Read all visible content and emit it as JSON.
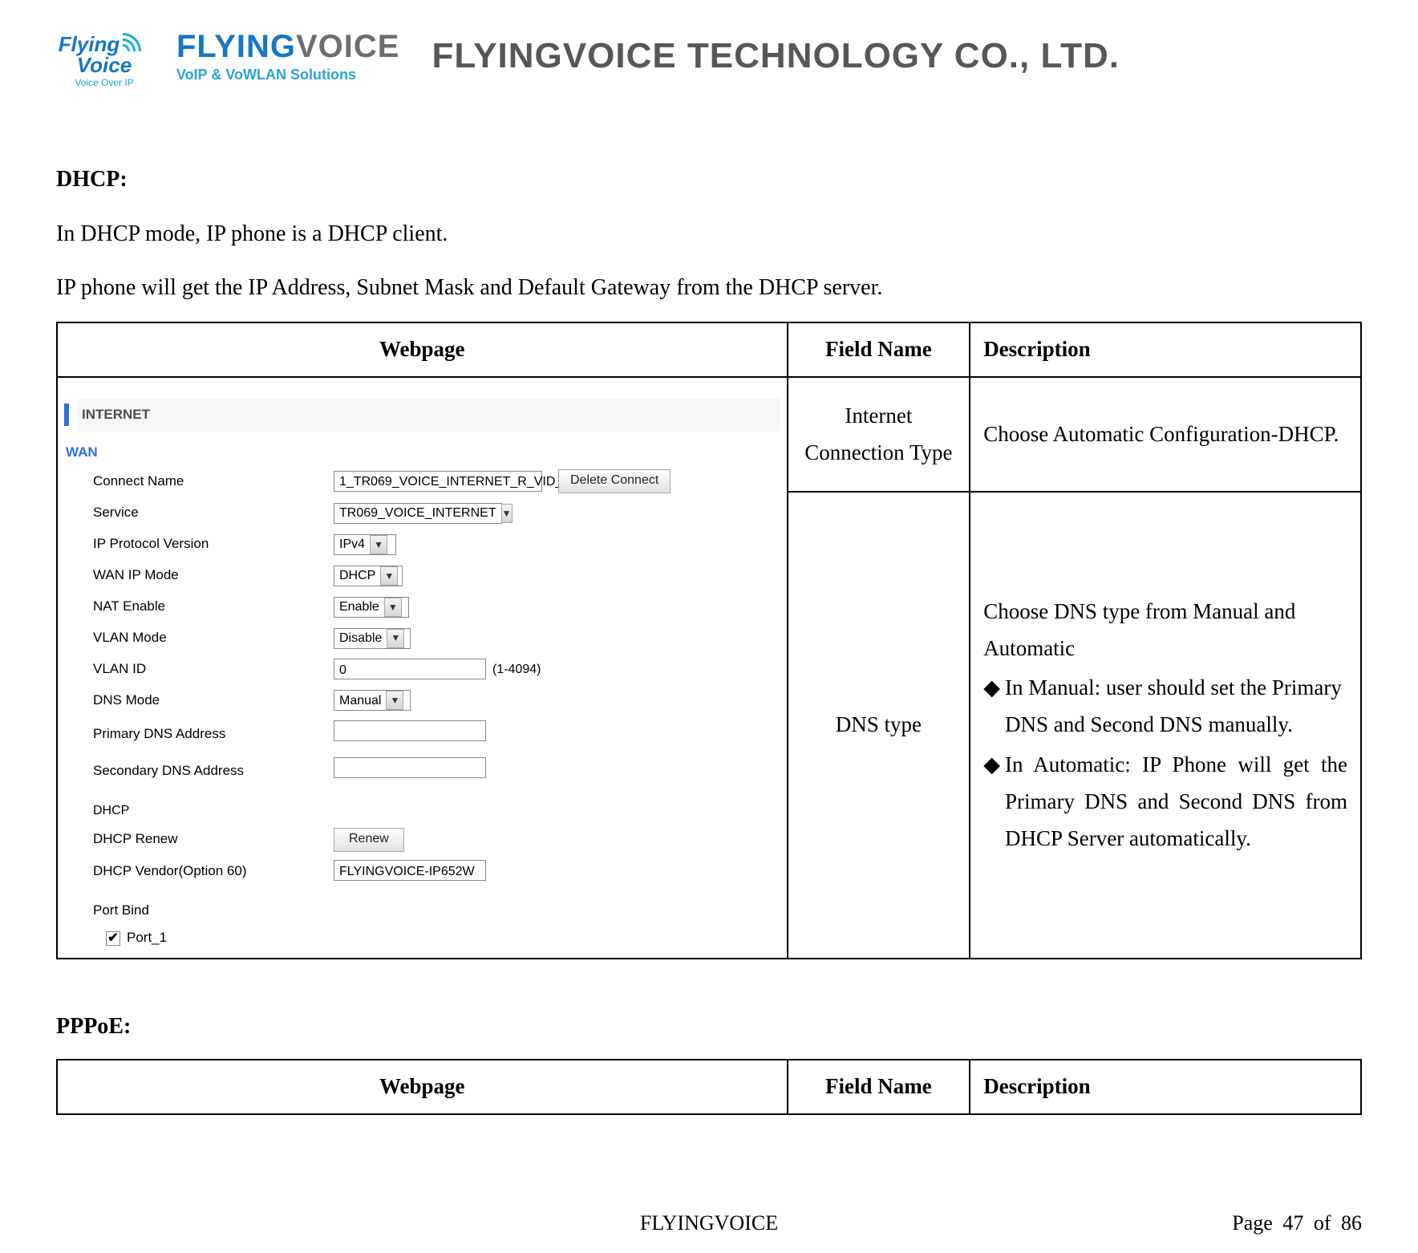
{
  "header": {
    "mark_line1": "Flying",
    "mark_line2": "Voice",
    "mark_tag": "Voice Over IP",
    "wordmark_flying": "FLYING",
    "wordmark_voice": "VOICE",
    "wordmark_sub": "VoIP & VoWLAN Solutions",
    "company": "FLYINGVOICE TECHNOLOGY CO., LTD."
  },
  "body": {
    "dhcp_heading": "DHCP:",
    "dhcp_para1": "In DHCP mode, IP phone is a DHCP client.",
    "dhcp_para2": "IP phone will get the IP Address, Subnet Mask and Default Gateway from the DHCP server.",
    "table_headers": {
      "webpage": "Webpage",
      "field": "Field Name",
      "desc": "Description"
    },
    "rows": {
      "r1_field": "Internet Connection Type",
      "r1_desc": "Choose Automatic Configuration-DHCP.",
      "r2_field": "DNS type",
      "r2_desc_intro": "Choose DNS type from Manual and Automatic",
      "r2_desc_b1": "In Manual: user should set the Primary DNS and Second DNS manually.",
      "r2_desc_b2": "In Automatic: IP Phone will get the Primary DNS and Second DNS from DHCP Server automatically."
    },
    "pppoe_heading": "PPPoE:"
  },
  "panel": {
    "internet_header": "INTERNET",
    "wan_label": "WAN",
    "fields": {
      "connect_name": "Connect Name",
      "service": "Service",
      "ip_protocol": "IP Protocol Version",
      "wan_ip_mode": "WAN IP Mode",
      "nat_enable": "NAT Enable",
      "vlan_mode": "VLAN Mode",
      "vlan_id": "VLAN ID",
      "dns_mode": "DNS Mode",
      "primary_dns": "Primary DNS Address",
      "secondary_dns": "Secondary DNS Address",
      "dhcp_section": "DHCP",
      "dhcp_renew": "DHCP Renew",
      "dhcp_vendor": "DHCP Vendor(Option 60)",
      "port_bind": "Port Bind",
      "port1": "Port_1"
    },
    "values": {
      "connect_name": "1_TR069_VOICE_INTERNET_R_VID_",
      "service": "TR069_VOICE_INTERNET",
      "ip_protocol": "IPv4",
      "wan_ip_mode": "DHCP",
      "nat_enable": "Enable",
      "vlan_mode": "Disable",
      "vlan_id": "0",
      "vlan_hint": "(1-4094)",
      "dns_mode": "Manual",
      "primary_dns": "",
      "secondary_dns": "",
      "dhcp_renew_btn": "Renew",
      "dhcp_vendor": "FLYINGVOICE-IP652W",
      "delete_btn": "Delete Connect",
      "port1_checked": "✔"
    }
  },
  "footer": {
    "center": "FLYINGVOICE",
    "page_label": "Page  47  of  86"
  }
}
